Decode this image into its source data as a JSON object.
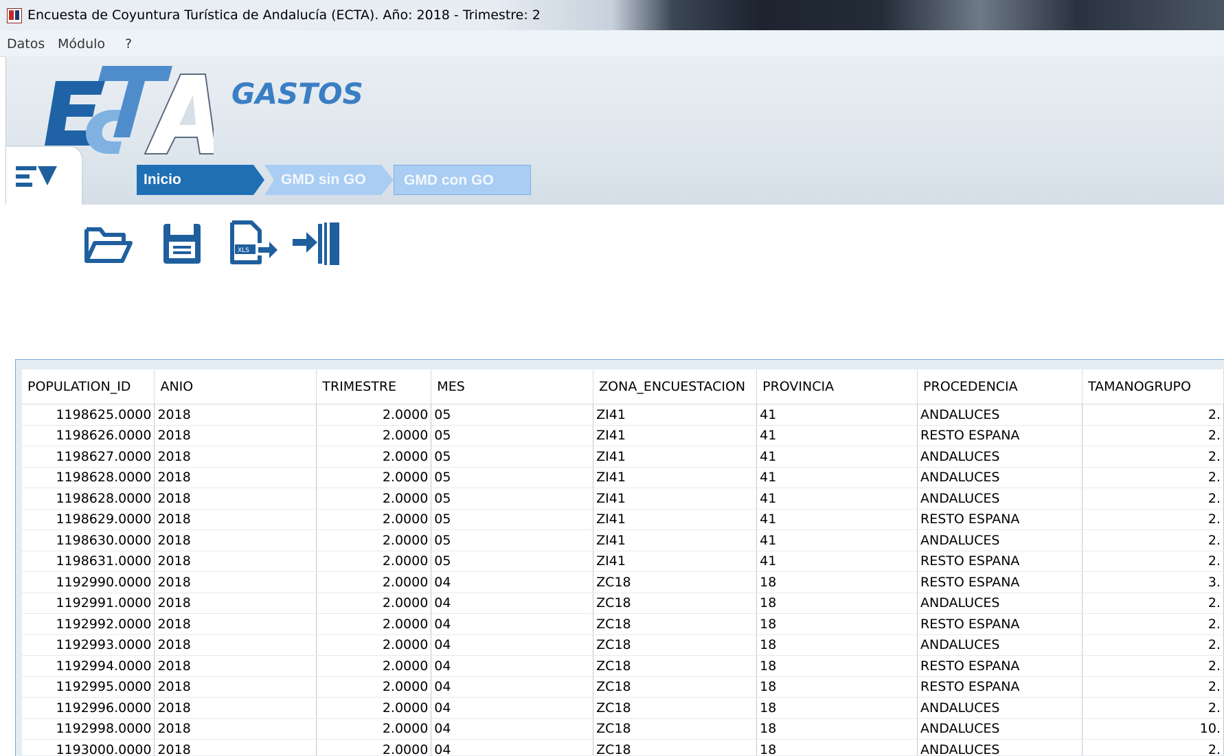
{
  "window": {
    "title": "Encuesta de Coyuntura Turística de Andalucía (ECTA). Año: 2018 - Trimestre: 2"
  },
  "menu": {
    "items": [
      "Datos",
      "Módulo",
      "?"
    ]
  },
  "header": {
    "logo_text": "ECTA",
    "module_title": "GASTOS",
    "breadcrumbs": [
      "Inicio",
      "GMD sin GO",
      "GMD con GO"
    ]
  },
  "toolbar": {
    "icons": [
      "open-folder-icon",
      "save-icon",
      "export-xls-icon",
      "exit-icon"
    ]
  },
  "table": {
    "columns": [
      "POPULATION_ID",
      "ANIO",
      "TRIMESTRE",
      "MES",
      "ZONA_ENCUESTACION",
      "PROVINCIA",
      "PROCEDENCIA",
      "TAMANOGRUPO"
    ],
    "rows": [
      [
        "1198625.0000",
        "2018",
        "2.0000",
        "05",
        "ZI41",
        "41",
        "ANDALUCES",
        "2."
      ],
      [
        "1198626.0000",
        "2018",
        "2.0000",
        "05",
        "ZI41",
        "41",
        "RESTO ESPANA",
        "2."
      ],
      [
        "1198627.0000",
        "2018",
        "2.0000",
        "05",
        "ZI41",
        "41",
        "ANDALUCES",
        "2."
      ],
      [
        "1198628.0000",
        "2018",
        "2.0000",
        "05",
        "ZI41",
        "41",
        "ANDALUCES",
        "2."
      ],
      [
        "1198628.0000",
        "2018",
        "2.0000",
        "05",
        "ZI41",
        "41",
        "ANDALUCES",
        "2."
      ],
      [
        "1198629.0000",
        "2018",
        "2.0000",
        "05",
        "ZI41",
        "41",
        "RESTO ESPANA",
        "2."
      ],
      [
        "1198630.0000",
        "2018",
        "2.0000",
        "05",
        "ZI41",
        "41",
        "ANDALUCES",
        "2."
      ],
      [
        "1198631.0000",
        "2018",
        "2.0000",
        "05",
        "ZI41",
        "41",
        "RESTO ESPANA",
        "2."
      ],
      [
        "1192990.0000",
        "2018",
        "2.0000",
        "04",
        "ZC18",
        "18",
        "RESTO ESPANA",
        "3."
      ],
      [
        "1192991.0000",
        "2018",
        "2.0000",
        "04",
        "ZC18",
        "18",
        "ANDALUCES",
        "2."
      ],
      [
        "1192992.0000",
        "2018",
        "2.0000",
        "04",
        "ZC18",
        "18",
        "RESTO ESPANA",
        "2."
      ],
      [
        "1192993.0000",
        "2018",
        "2.0000",
        "04",
        "ZC18",
        "18",
        "ANDALUCES",
        "2."
      ],
      [
        "1192994.0000",
        "2018",
        "2.0000",
        "04",
        "ZC18",
        "18",
        "RESTO ESPANA",
        "2."
      ],
      [
        "1192995.0000",
        "2018",
        "2.0000",
        "04",
        "ZC18",
        "18",
        "RESTO ESPANA",
        "2."
      ],
      [
        "1192996.0000",
        "2018",
        "2.0000",
        "04",
        "ZC18",
        "18",
        "ANDALUCES",
        "2."
      ],
      [
        "1192998.0000",
        "2018",
        "2.0000",
        "04",
        "ZC18",
        "18",
        "ANDALUCES",
        "10."
      ],
      [
        "1193000.0000",
        "2018",
        "2.0000",
        "04",
        "ZC18",
        "18",
        "ANDALUCES",
        "2."
      ]
    ]
  }
}
